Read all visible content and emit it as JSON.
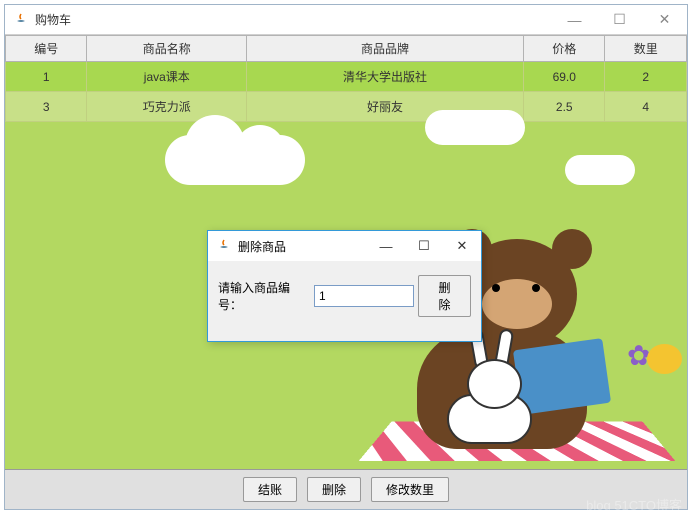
{
  "main_window": {
    "title": "购物车",
    "table": {
      "headers": [
        "编号",
        "商品名称",
        "商品品牌",
        "价格",
        "数里"
      ],
      "rows": [
        {
          "id": "1",
          "name": "java课本",
          "brand": "清华大学出版社",
          "price": "69.0",
          "qty": "2"
        },
        {
          "id": "3",
          "name": "巧克力派",
          "brand": "好丽友",
          "price": "2.5",
          "qty": "4"
        }
      ]
    },
    "buttons": {
      "checkout": "结账",
      "delete": "删除",
      "modify_qty": "修改数里"
    }
  },
  "dialog": {
    "title": "删除商品",
    "prompt": "请输入商品编号：",
    "input_value": "1",
    "delete_btn": "删除"
  },
  "watermark": "blog 51CTO博客"
}
